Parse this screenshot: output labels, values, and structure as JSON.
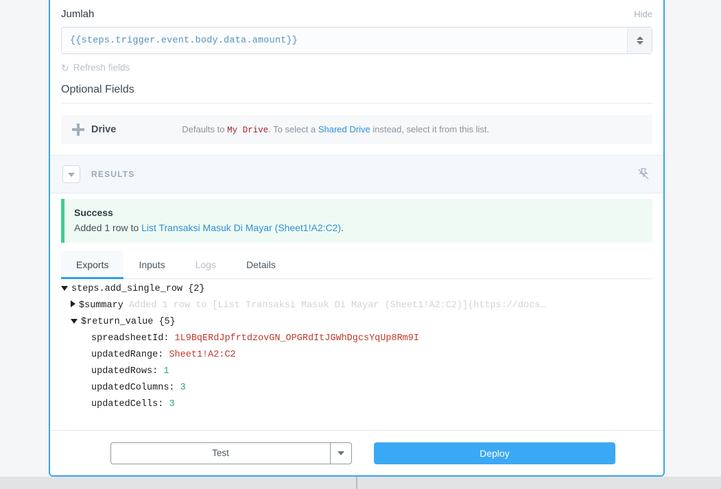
{
  "field": {
    "label": "Jumlah",
    "hide_label": "Hide",
    "value": "{{steps.trigger.event.body.data.amount}}",
    "refresh_label": "Refresh fields"
  },
  "optional": {
    "title": "Optional Fields",
    "drive": {
      "name": "Drive",
      "desc_prefix": "Defaults to",
      "desc_code": "My Drive",
      "desc_middle": ". To select a",
      "desc_link": "Shared Drive",
      "desc_suffix": "instead, select it from this list."
    }
  },
  "results": {
    "label": "RESULTS",
    "pin_icon": "unpin-icon",
    "chevron_icon": "chevron-down-icon"
  },
  "banner": {
    "title": "Success",
    "text_prefix": "Added 1 row to",
    "link": "List Transaksi Masuk Di Mayar (Sheet1!A2:C2)",
    "text_suffix": "."
  },
  "tabs": [
    {
      "label": "Exports",
      "state": "active"
    },
    {
      "label": "Inputs",
      "state": "normal"
    },
    {
      "label": "Logs",
      "state": "disabled"
    },
    {
      "label": "Details",
      "state": "normal"
    }
  ],
  "tree": {
    "root_key": "steps.add_single_row",
    "root_count": "{2}",
    "summary_key": "$summary",
    "summary_value": "Added 1 row to [List Transaksi Masuk Di Mayar (Sheet1!A2:C2)](https://docs…",
    "return_key": "$return_value",
    "return_count": "{5}",
    "rows": [
      {
        "key": "spreadsheetId:",
        "value": "1L9BqERdJpfrtdzovGN_OPGRdItJGWhDgcsYqUp8Rm9I",
        "type": "string"
      },
      {
        "key": "updatedRange:",
        "value": "Sheet1!A2:C2",
        "type": "string"
      },
      {
        "key": "updatedRows:",
        "value": "1",
        "type": "number"
      },
      {
        "key": "updatedColumns:",
        "value": "3",
        "type": "number"
      },
      {
        "key": "updatedCells:",
        "value": "3",
        "type": "number"
      }
    ]
  },
  "footer": {
    "test_label": "Test",
    "test_caret_icon": "chevron-down-icon",
    "deploy_label": "Deploy"
  },
  "colors": {
    "accent_blue": "#3ba8f5",
    "card_border": "#3ca2e8",
    "success_green": "#3ecf8e",
    "success_bg": "#eefaf3",
    "string_red": "#c0392b",
    "number_teal": "#27a383"
  }
}
